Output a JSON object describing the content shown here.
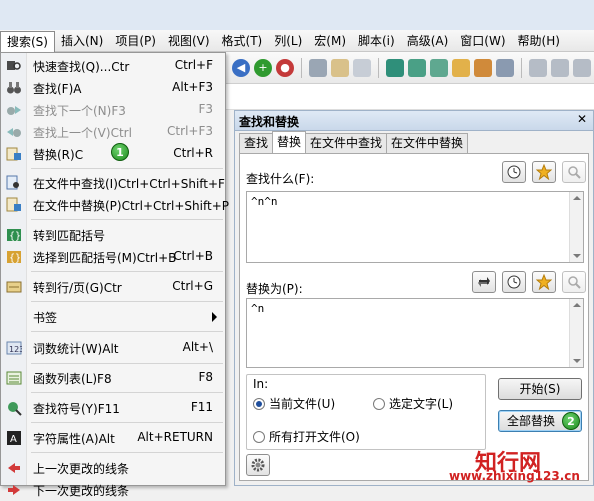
{
  "menubar": [
    {
      "label": "搜索(S)",
      "active": true
    },
    {
      "label": "插入(N)"
    },
    {
      "label": "项目(P)"
    },
    {
      "label": "视图(V)"
    },
    {
      "label": "格式(T)"
    },
    {
      "label": "列(L)"
    },
    {
      "label": "宏(M)"
    },
    {
      "label": "脚本(i)"
    },
    {
      "label": "高级(A)"
    },
    {
      "label": "窗口(W)"
    },
    {
      "label": "帮助(H)"
    }
  ],
  "search_menu": [
    {
      "label": "快速查找(Q)...Ctr",
      "shortcut": "Ctrl+F",
      "icon": "quick-find-icon",
      "disabled": false
    },
    {
      "label": "查找(F)A",
      "shortcut": "Alt+F3",
      "icon": "binoculars-icon",
      "disabled": false
    },
    {
      "label": "查找下一个(N)F3",
      "shortcut": "F3",
      "icon": "find-next-icon",
      "disabled": true
    },
    {
      "label": "查找上一个(V)Ctrl",
      "shortcut": "Ctrl+F3",
      "icon": "find-previous-icon",
      "disabled": true
    },
    {
      "label": "替换(R)C",
      "shortcut": "Ctrl+R",
      "icon": "replace-icon",
      "disabled": false
    },
    {
      "label": "在文件中查找(I)Ctrl+Ctrl+Shift+F",
      "shortcut": "",
      "icon": "find-in-files-icon",
      "disabled": false
    },
    {
      "label": "在文件中替换(P)Ctrl+Ctrl+Shift+P",
      "shortcut": "",
      "icon": "replace-in-files-icon",
      "disabled": false
    },
    {
      "label": "转到匹配括号",
      "shortcut": "",
      "icon": "match-brace-icon",
      "disabled": false
    },
    {
      "label": "选择到匹配括号(M)Ctrl+B",
      "shortcut": "Ctrl+B",
      "icon": "select-brace-icon",
      "disabled": false
    },
    {
      "label": "转到行/页(G)Ctr",
      "shortcut": "Ctrl+G",
      "icon": "goto-line-icon",
      "disabled": false
    },
    {
      "label": "书签",
      "shortcut": "",
      "icon": "",
      "disabled": false,
      "submenu": true
    },
    {
      "label": "词数统计(W)Alt",
      "shortcut": "Alt+\\",
      "icon": "word-count-icon",
      "disabled": false
    },
    {
      "label": "函数列表(L)F8",
      "shortcut": "F8",
      "icon": "function-list-icon",
      "disabled": false
    },
    {
      "label": "查找符号(Y)F11",
      "shortcut": "F11",
      "icon": "find-symbol-icon",
      "disabled": false
    },
    {
      "label": "字符属性(A)Alt",
      "shortcut": "Alt+RETURN",
      "icon": "char-props-icon",
      "disabled": false
    },
    {
      "label": "上一次更改的线条",
      "shortcut": "",
      "icon": "prev-change-icon",
      "disabled": false
    },
    {
      "label": "下一次更改的线条",
      "shortcut": "",
      "icon": "next-change-icon",
      "disabled": false
    }
  ],
  "badges": {
    "one": "1",
    "two": "2"
  },
  "panel": {
    "title": "查找和替换",
    "close": "✕",
    "tabs": [
      "查找",
      "替换",
      "在文件中查找",
      "在文件中替换"
    ],
    "selected_tab": 1,
    "find_label": "查找什么(F):",
    "find_value": "^n^n",
    "replace_label": "替换为(P):",
    "replace_value": "^n",
    "in_label": "In:",
    "options": {
      "current_file": "当前文件(U)",
      "selected_text": "选定文字(L)",
      "all_open_files": "所有打开文件(O)"
    },
    "start_button": "开始(S)",
    "replace_all_button": "全部替换"
  },
  "watermark": {
    "brand": "知行网",
    "url": "www.zhixing123.cn"
  },
  "colors": {
    "accent": "#1f4e9c",
    "badge": "#2a9a2a",
    "watermark": "#d12222"
  }
}
